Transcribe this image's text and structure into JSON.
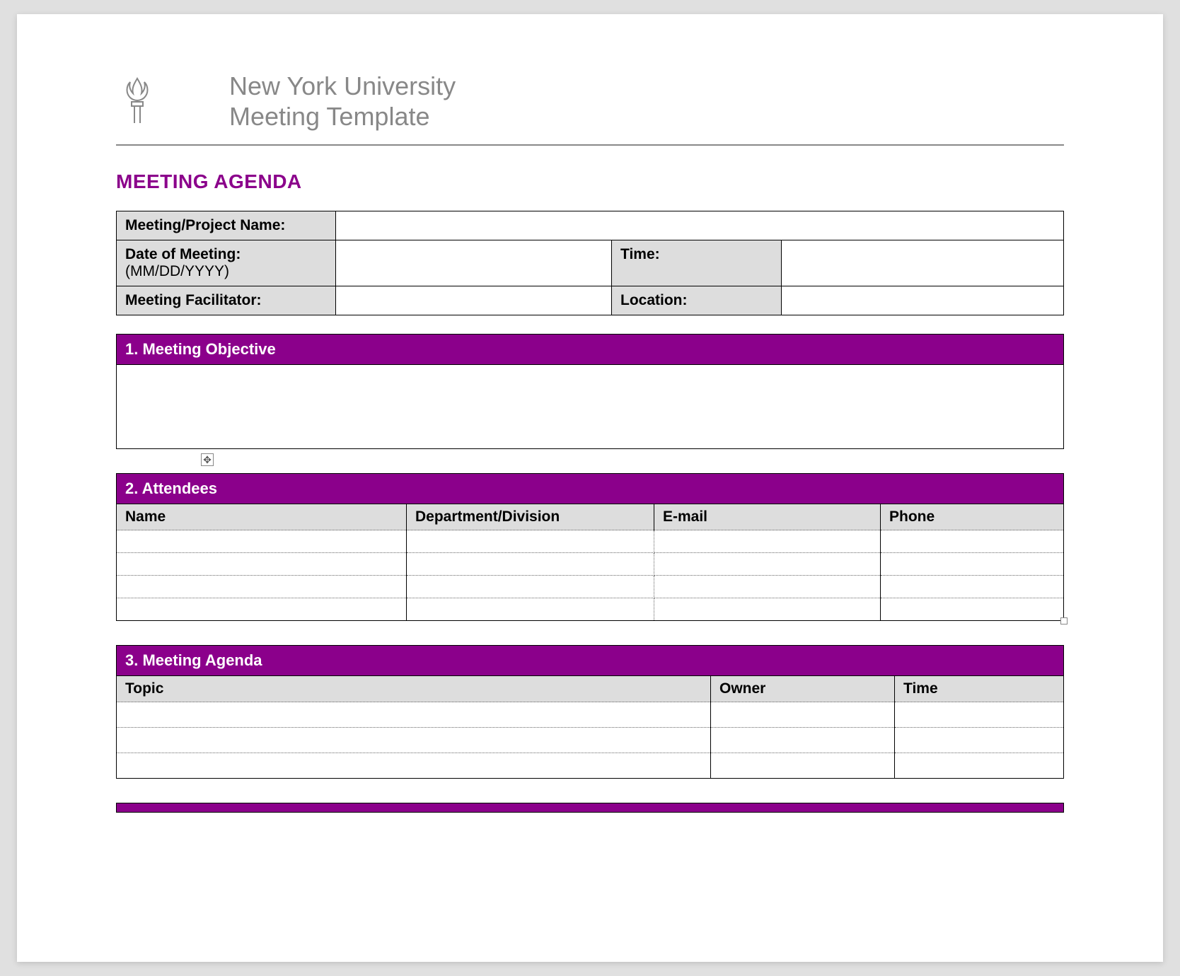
{
  "header": {
    "title_line1": "New York University",
    "title_line2": "Meeting Template"
  },
  "agenda_title": "MEETING AGENDA",
  "info": {
    "project_label": "Meeting/Project Name:",
    "project_value": "",
    "date_label": "Date of Meeting:",
    "date_format": "(MM/DD/YYYY)",
    "date_value": "",
    "time_label": "Time:",
    "time_value": "",
    "facilitator_label": "Meeting Facilitator:",
    "facilitator_value": "",
    "location_label": "Location:",
    "location_value": ""
  },
  "sections": {
    "objective": {
      "title": "1. Meeting Objective",
      "body": ""
    },
    "attendees": {
      "title": "2. Attendees",
      "cols": {
        "name": "Name",
        "dept": "Department/Division",
        "email": "E-mail",
        "phone": "Phone"
      },
      "rows": [
        {
          "name": "",
          "dept": "",
          "email": "",
          "phone": ""
        },
        {
          "name": "",
          "dept": "",
          "email": "",
          "phone": ""
        },
        {
          "name": "",
          "dept": "",
          "email": "",
          "phone": ""
        },
        {
          "name": "",
          "dept": "",
          "email": "",
          "phone": ""
        }
      ]
    },
    "agenda": {
      "title": "3. Meeting Agenda",
      "cols": {
        "topic": "Topic",
        "owner": "Owner",
        "time": "Time"
      },
      "rows": [
        {
          "topic": "",
          "owner": "",
          "time": ""
        },
        {
          "topic": "",
          "owner": "",
          "time": ""
        },
        {
          "topic": "",
          "owner": "",
          "time": ""
        }
      ]
    }
  }
}
